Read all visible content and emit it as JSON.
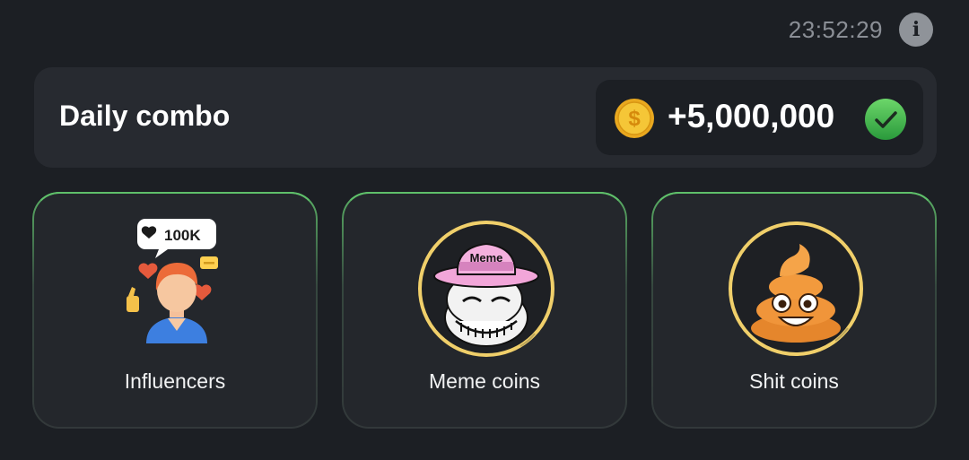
{
  "header": {
    "timer": "23:52:29",
    "info_icon": "info-icon",
    "info_glyph": "i"
  },
  "daily_combo": {
    "title": "Daily combo",
    "reward_amount": "+5,000,000",
    "coin_icon": "gold-coin-icon",
    "status_icon": "checkmark-icon",
    "status": "completed"
  },
  "cards": [
    {
      "label": "Influencers",
      "image": "influencer-illustration",
      "badge_text": "100K"
    },
    {
      "label": "Meme coins",
      "image": "troll-face-meme-illustration",
      "hat_text": "Meme"
    },
    {
      "label": "Shit coins",
      "image": "poop-emoji-illustration"
    }
  ],
  "colors": {
    "background": "#1c1f24",
    "panel": "#272a30",
    "card_border_accent": "#5fbf6a",
    "coin_gold": "#f2b829",
    "check_green": "#3bb64a",
    "timer_text": "#8b8f96"
  }
}
